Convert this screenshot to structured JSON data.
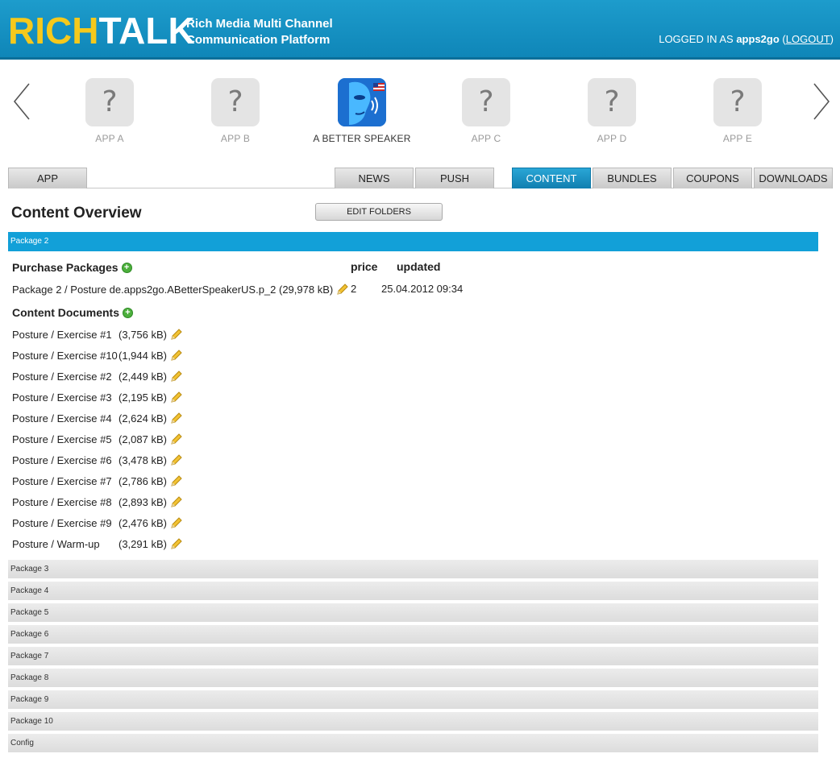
{
  "header": {
    "logo_rich": "RICH",
    "logo_talk": "TALK",
    "tagline_line1": "Rich Media Multi Channel",
    "tagline_line2": "Communication Platform",
    "login_prefix": "LOGGED IN AS",
    "username": "apps2go",
    "logout_label": "LOGOUT"
  },
  "carousel": {
    "apps": [
      {
        "label": "APP A",
        "icon": "question-mark-icon",
        "glyph": "?"
      },
      {
        "label": "APP B",
        "icon": "question-mark-icon",
        "glyph": "?"
      },
      {
        "label": "A BETTER SPEAKER",
        "icon": "speaker-face-icon",
        "glyph": ""
      },
      {
        "label": "APP C",
        "icon": "question-mark-icon",
        "glyph": "?"
      },
      {
        "label": "APP D",
        "icon": "question-mark-icon",
        "glyph": "?"
      },
      {
        "label": "APP E",
        "icon": "question-mark-icon",
        "glyph": "?"
      }
    ]
  },
  "tabs": {
    "app": "APP",
    "news": "NEWS",
    "push": "PUSH",
    "content": "CONTENT",
    "bundles": "BUNDLES",
    "coupons": "COUPONS",
    "downloads": "DOWNLOADS",
    "active": "CONTENT"
  },
  "main": {
    "title": "Content Overview",
    "edit_folders": "EDIT FOLDERS",
    "open_package": "Package 2",
    "purchase_packages_heading": "Purchase Packages",
    "col_price": "price",
    "col_updated": "updated",
    "purchase_row": {
      "name": "Package 2 / Posture de.apps2go.ABetterSpeakerUS.p_2 (29,978 kB)",
      "price": "2",
      "updated": "25.04.2012 09:34"
    },
    "content_documents_heading": "Content Documents",
    "documents": [
      {
        "name": "Posture / Exercise #1",
        "size": "(3,756 kB)"
      },
      {
        "name": "Posture / Exercise #10",
        "size": "(1,944 kB)"
      },
      {
        "name": "Posture / Exercise #2",
        "size": "(2,449 kB)"
      },
      {
        "name": "Posture / Exercise #3",
        "size": "(2,195 kB)"
      },
      {
        "name": "Posture / Exercise #4",
        "size": "(2,624 kB)"
      },
      {
        "name": "Posture / Exercise #5",
        "size": "(2,087 kB)"
      },
      {
        "name": "Posture / Exercise #6",
        "size": "(3,478 kB)"
      },
      {
        "name": "Posture / Exercise #7",
        "size": "(2,786 kB)"
      },
      {
        "name": "Posture / Exercise #8",
        "size": "(2,893 kB)"
      },
      {
        "name": "Posture / Exercise #9",
        "size": "(2,476 kB)"
      },
      {
        "name": "Posture / Warm-up",
        "size": "(3,291 kB)"
      }
    ],
    "collapsed_packages": [
      "Package 3",
      "Package 4",
      "Package 5",
      "Package 6",
      "Package 7",
      "Package 8",
      "Package 9",
      "Package 10",
      "Config"
    ]
  },
  "colors": {
    "header_blue": "#1d9ccc",
    "logo_yellow": "#f5c91c",
    "active_tab": "#1a93c6",
    "open_package_bar": "#12a0d8",
    "add_green": "#4caf3c"
  }
}
